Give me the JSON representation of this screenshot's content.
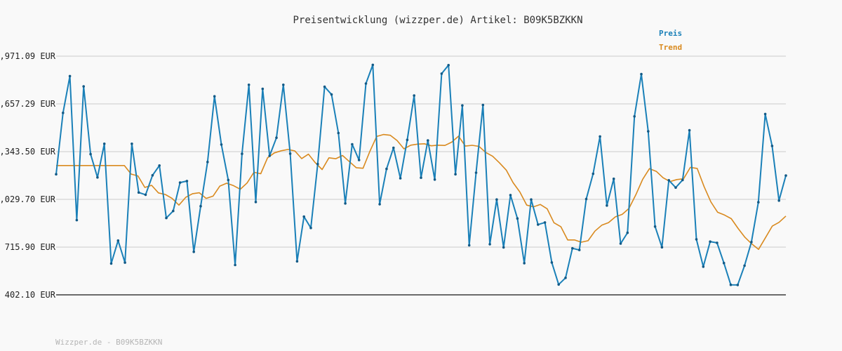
{
  "chart_data": {
    "type": "line",
    "title": "Preisentwicklung (wizzper.de) Artikel: B09K5BZKKN",
    "y_ticks": [
      "1,971.09 EUR",
      "1,657.29 EUR",
      "1,343.50 EUR",
      "1,029.70 EUR",
      "715.90 EUR",
      "402.10 EUR"
    ],
    "ylim": [
      402.1,
      1971.09
    ],
    "grid": true,
    "legend_placement": "top-right",
    "series": [
      {
        "name": "Preis",
        "color": "#1a80b8",
        "values": [
          1195,
          1598,
          1840,
          893,
          1772,
          1327,
          1174,
          1395,
          608,
          759,
          614,
          1395,
          1075,
          1060,
          1188,
          1252,
          907,
          953,
          1140,
          1150,
          685,
          985,
          1275,
          1707,
          1390,
          1157,
          598,
          1329,
          1783,
          1012,
          1756,
          1316,
          1435,
          1783,
          1330,
          622,
          916,
          842,
          1262,
          1770,
          1719,
          1466,
          1003,
          1392,
          1288,
          1791,
          1914,
          998,
          1230,
          1369,
          1168,
          1421,
          1712,
          1172,
          1417,
          1160,
          1856,
          1912,
          1195,
          1647,
          728,
          1205,
          1650,
          735,
          1029,
          714,
          1058,
          904,
          610,
          1029,
          864,
          878,
          615,
          470,
          514,
          708,
          697,
          1032,
          1198,
          1443,
          989,
          1165,
          739,
          810,
          1575,
          1853,
          1477,
          851,
          715,
          1155,
          1107,
          1157,
          1484,
          767,
          587,
          752,
          744,
          611,
          468,
          467,
          594,
          749,
          1011,
          1591,
          1381,
          1022,
          1186
        ],
        "x_span": [
          80,
          1120
        ]
      },
      {
        "name": "Trend",
        "color": "#d98a1f",
        "values": [
          1252,
          1252,
          1252,
          1252,
          1252,
          1252,
          1252,
          1252,
          1252,
          1252,
          1252,
          1196,
          1184,
          1108,
          1122,
          1072,
          1062,
          1036,
          992,
          1043,
          1067,
          1073,
          1036,
          1051,
          1117,
          1136,
          1120,
          1096,
          1137,
          1208,
          1198,
          1303,
          1335,
          1349,
          1358,
          1348,
          1298,
          1327,
          1271,
          1226,
          1303,
          1297,
          1318,
          1278,
          1238,
          1234,
          1345,
          1443,
          1456,
          1451,
          1416,
          1362,
          1386,
          1393,
          1395,
          1382,
          1386,
          1384,
          1406,
          1445,
          1380,
          1385,
          1378,
          1338,
          1313,
          1270,
          1222,
          1140,
          1078,
          992,
          981,
          996,
          968,
          876,
          850,
          763,
          763,
          748,
          758,
          821,
          860,
          877,
          915,
          931,
          970,
          1060,
          1161,
          1232,
          1214,
          1172,
          1147,
          1160,
          1165,
          1240,
          1233,
          1114,
          1013,
          945,
          927,
          903,
          838,
          780,
          737,
          701,
          777,
          854,
          879,
          920
        ],
        "x_span": [
          80,
          1120
        ]
      }
    ]
  },
  "footer": "Wizzper.de - B09K5BZKKN"
}
